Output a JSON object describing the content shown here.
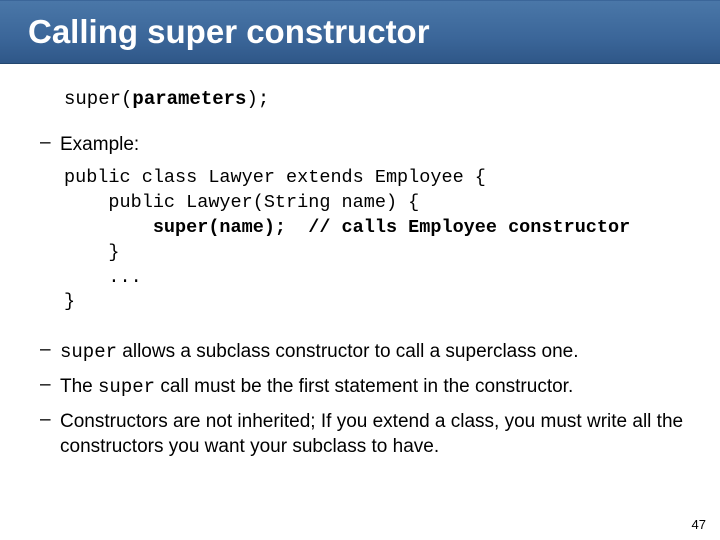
{
  "title": "Calling super constructor",
  "syntax": {
    "l": "super(",
    "mid": "parameters",
    "r": ");"
  },
  "example_label": "Example:",
  "code": {
    "l1": "public class Lawyer extends Employee {",
    "l2": "    public Lawyer(String name) {",
    "l3a": "        super(name);",
    "l3b": "  // calls Employee constructor",
    "l4": "    }",
    "l5": "    ...",
    "l6": "}"
  },
  "bullets": {
    "b1a": "super",
    "b1b": " allows a subclass constructor to call a superclass one.",
    "b2a": "The ",
    "b2b": "super",
    "b2c": " call must be the first statement in the constructor.",
    "b3": "Constructors are not inherited; If you extend a class, you must write all the constructors you want your subclass to have."
  },
  "page_number": "47"
}
